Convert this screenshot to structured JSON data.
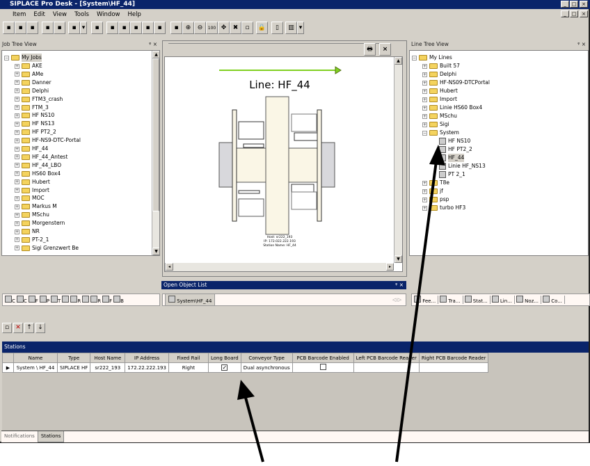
{
  "window": {
    "title": "SIPLACE Pro Desk - [System\\HF_44]"
  },
  "menu": [
    "Item",
    "Edit",
    "View",
    "Tools",
    "Window",
    "Help"
  ],
  "toolbar": {
    "zoom_100": "100"
  },
  "job_tree": {
    "title": "Job Tree View",
    "root": "My Jobs",
    "items": [
      "AKE",
      "AMe",
      "Danner",
      "Delphi",
      "FTM3_crash",
      "FTM_3",
      "HF NS10",
      "HF NS13",
      "HF PT2_2",
      "HF-NS9-DTC-Portal",
      "HF_44",
      "HF_44_Antest",
      "HF_44_LBO",
      "HS60 Box4",
      "Hubert",
      "Import",
      "MOC",
      "Markus M",
      "MSchu",
      "Morgenstern",
      "NR",
      "PT-2_1",
      "Sigi Grenzwert Be"
    ]
  },
  "line_tree": {
    "title": "Line Tree View",
    "root": "My Lines",
    "folders_before": [
      "Built 57",
      "Delphi",
      "HF-NS09-DTCPortal",
      "Hubert",
      "Import",
      "Linie HS60 Box4",
      "MSchu",
      "Sigi"
    ],
    "system": "System",
    "system_children": [
      "HF NS10",
      "HF PT2_2",
      "HF_44",
      "Linie HF_NS13",
      "PT 2_1"
    ],
    "selected": "HF_44",
    "folders_after": [
      "T8e",
      "jf",
      "psp",
      "turbo HF3"
    ]
  },
  "canvas": {
    "line_title": "Line: HF_44",
    "host": "Host: sr222_193",
    "ip": "IP: 172.022.222.193",
    "station_name": "Station Name: HF_44"
  },
  "open_object_list": {
    "title": "Open Object List",
    "tab": "System\\HF_44"
  },
  "left_tabs": [
    "C",
    "C",
    "F",
    "P",
    "T",
    "",
    "R",
    "",
    "R",
    "F",
    "B"
  ],
  "right_tabs": [
    "Fee...",
    "Tra...",
    "Stat...",
    "Lin...",
    "Noz...",
    "Co..."
  ],
  "stations": {
    "title": "Stations",
    "columns": [
      "Name",
      "Type",
      "Host Name",
      "IP Address",
      "Fixed Rail",
      "Long Board",
      "Conveyor Type",
      "PCB Barcode Enabled",
      "Left PCB Barcode Reader",
      "Right PCB Barcode Reader"
    ],
    "rows": [
      {
        "name": "System \\ HF_44",
        "type": "SIPLACE HF",
        "host": "sr222_193",
        "ip": "172.22.222.193",
        "fixed_rail": "Right",
        "long_board": true,
        "conveyor": "Dual asynchronous",
        "pcb_barcode": false,
        "left_reader": "",
        "right_reader": ""
      }
    ]
  },
  "bottom_tabs": [
    "Notifications",
    "Stations"
  ],
  "colors": {
    "title_bar": "#0a246a",
    "panel": "#d4d0c8",
    "arrow": "#80d020",
    "folder": "#f4d35e"
  }
}
